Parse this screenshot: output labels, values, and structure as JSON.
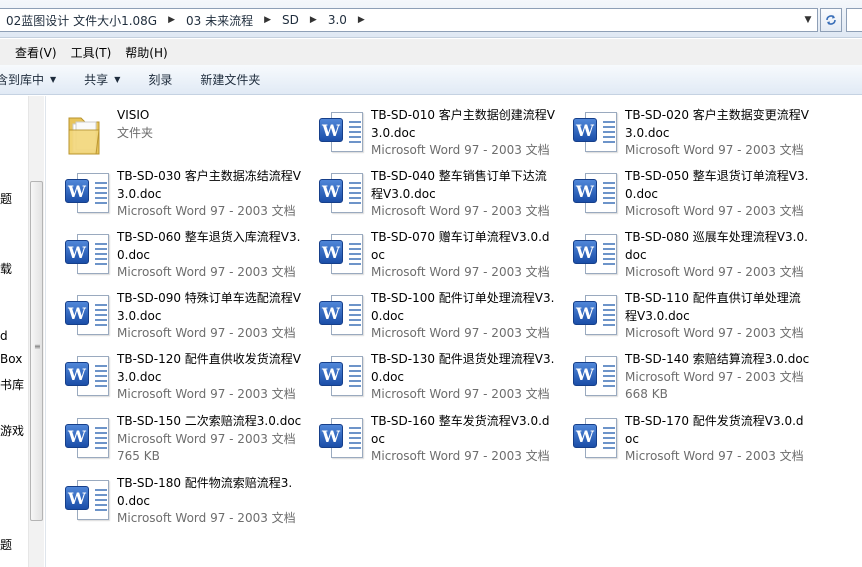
{
  "address": {
    "crumbs": [
      "02蓝图设计 文件大小1.08G",
      "03 未来流程",
      "SD",
      "3.0"
    ]
  },
  "menu": [
    "查看(V)",
    "工具(T)",
    "帮助(H)"
  ],
  "toolbar": {
    "include_library": "含到库中",
    "share": "共享",
    "burn": "刻录",
    "new_folder": "新建文件夹"
  },
  "nav": [
    "题",
    "载",
    "d",
    "Box",
    "书库",
    "游戏",
    "题"
  ],
  "files": [
    {
      "type": "folder",
      "name": "VISIO",
      "meta": [
        "文件夹"
      ]
    },
    {
      "type": "word",
      "name": "TB-SD-010 客户主数据创建流程V3.0.doc",
      "meta": [
        "Microsoft Word 97 - 2003 文档"
      ]
    },
    {
      "type": "word",
      "name": "TB-SD-020 客户主数据变更流程V3.0.doc",
      "meta": [
        "Microsoft Word 97 - 2003 文档"
      ]
    },
    {
      "type": "word",
      "name": "TB-SD-030 客户主数据冻结流程V3.0.doc",
      "meta": [
        "Microsoft Word 97 - 2003 文档"
      ]
    },
    {
      "type": "word",
      "name": "TB-SD-040 整车销售订单下达流程V3.0.doc",
      "meta": [
        "Microsoft Word 97 - 2003 文档"
      ]
    },
    {
      "type": "word",
      "name": "TB-SD-050 整车退货订单流程V3.0.doc",
      "meta": [
        "Microsoft Word 97 - 2003 文档"
      ]
    },
    {
      "type": "word",
      "name": "TB-SD-060 整车退货入库流程V3.0.doc",
      "meta": [
        "Microsoft Word 97 - 2003 文档"
      ]
    },
    {
      "type": "word",
      "name": "TB-SD-070 赠车订单流程V3.0.doc",
      "meta": [
        "Microsoft Word 97 - 2003 文档"
      ]
    },
    {
      "type": "word",
      "name": "TB-SD-080 巡展车处理流程V3.0.doc",
      "meta": [
        "Microsoft Word 97 - 2003 文档"
      ]
    },
    {
      "type": "word",
      "name": "TB-SD-090 特殊订单车选配流程V3.0.doc",
      "meta": [
        "Microsoft Word 97 - 2003 文档"
      ]
    },
    {
      "type": "word",
      "name": "TB-SD-100 配件订单处理流程V3.0.doc",
      "meta": [
        "Microsoft Word 97 - 2003 文档"
      ]
    },
    {
      "type": "word",
      "name": "TB-SD-110 配件直供订单处理流程V3.0.doc",
      "meta": [
        "Microsoft Word 97 - 2003 文档"
      ]
    },
    {
      "type": "word",
      "name": "TB-SD-120 配件直供收发货流程V3.0.doc",
      "meta": [
        "Microsoft Word 97 - 2003 文档"
      ]
    },
    {
      "type": "word",
      "name": "TB-SD-130 配件退货处理流程V3.0.doc",
      "meta": [
        "Microsoft Word 97 - 2003 文档"
      ]
    },
    {
      "type": "word",
      "name": "TB-SD-140 索赔结算流程3.0.doc",
      "meta": [
        "Microsoft Word 97 - 2003 文档",
        "668 KB"
      ]
    },
    {
      "type": "word",
      "name": "TB-SD-150 二次索赔流程3.0.doc",
      "meta": [
        "Microsoft Word 97 - 2003 文档",
        "765 KB"
      ]
    },
    {
      "type": "word",
      "name": "TB-SD-160 整车发货流程V3.0.doc",
      "meta": [
        "Microsoft Word 97 - 2003 文档"
      ]
    },
    {
      "type": "word",
      "name": "TB-SD-170 配件发货流程V3.0.doc",
      "meta": [
        "Microsoft Word 97 - 2003 文档"
      ]
    },
    {
      "type": "word",
      "name": "TB-SD-180 配件物流索赔流程3.0.doc",
      "meta": [
        "Microsoft Word 97 - 2003 文档"
      ]
    }
  ]
}
